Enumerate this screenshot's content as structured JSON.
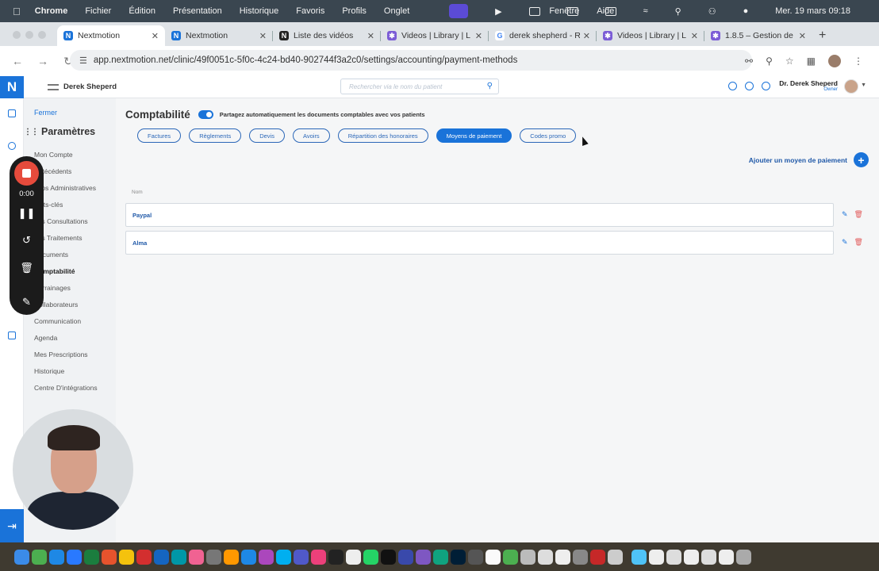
{
  "menubar": {
    "app": "Chrome",
    "items": [
      "Fichier",
      "Édition",
      "Présentation",
      "Historique",
      "Favoris",
      "Profils",
      "Onglet",
      "Fenêtre",
      "Aide"
    ],
    "clock": "Mer. 19 mars  09:18"
  },
  "browser": {
    "tabs": [
      {
        "title": "Nextmotion",
        "icon": "nextmotion-icon",
        "color": "#1a73d9"
      },
      {
        "title": "Nextmotion",
        "icon": "nextmotion-icon",
        "color": "#1a73d9"
      },
      {
        "title": "Liste des vidéos",
        "icon": "notion-icon",
        "color": "#222222"
      },
      {
        "title": "Videos | Library | L",
        "icon": "library-icon",
        "color": "#7b5cd6"
      },
      {
        "title": "derek shepherd - R",
        "icon": "google-icon",
        "color": "#4285f4"
      },
      {
        "title": "Videos | Library | L",
        "icon": "library-icon",
        "color": "#7b5cd6"
      },
      {
        "title": "1.8.5 – Gestion de",
        "icon": "library-icon",
        "color": "#7b5cd6"
      }
    ],
    "url": "app.nextmotion.net/clinic/49f0051c-5f0c-4c24-bd40-902744f3a2c0/settings/accounting/payment-methods"
  },
  "app": {
    "logo": "N",
    "clinic_name": "Derek Sheperd",
    "search_placeholder": "Rechercher via le nom du patient",
    "user_name": "Dr. Derek Sheperd",
    "user_role": "Owner"
  },
  "sidebar": {
    "close": "Fermer",
    "title": "Paramètres",
    "items": [
      "Mon Compte",
      "Antécédents",
      "Infos Administratives",
      "Mots-clés",
      "Les Consultations",
      "Les Traitements",
      "Documents",
      "Comptabilité",
      "Parrainages",
      "Collaborateurs",
      "Communication",
      "Agenda",
      "Mes Prescriptions",
      "Historique",
      "Centre D'intégrations"
    ]
  },
  "main": {
    "title": "Comptabilité",
    "share_label": "Partagez automatiquement les documents comptables avec vos patients",
    "share_enabled": true,
    "tabs": [
      "Factures",
      "Règlements",
      "Devis",
      "Avoirs",
      "Répartition des honoraires",
      "Moyens de paiement",
      "Codes promo"
    ],
    "active_tab": "Moyens de paiement",
    "add_label": "Ajouter un moyen de paiement",
    "column": "Nom",
    "methods": [
      "Paypal",
      "Alma"
    ]
  },
  "recorder": {
    "time": "0:00"
  },
  "colors": {
    "accent": "#1a73d9",
    "delete": "#e25c5c",
    "record": "#e64b3c"
  }
}
